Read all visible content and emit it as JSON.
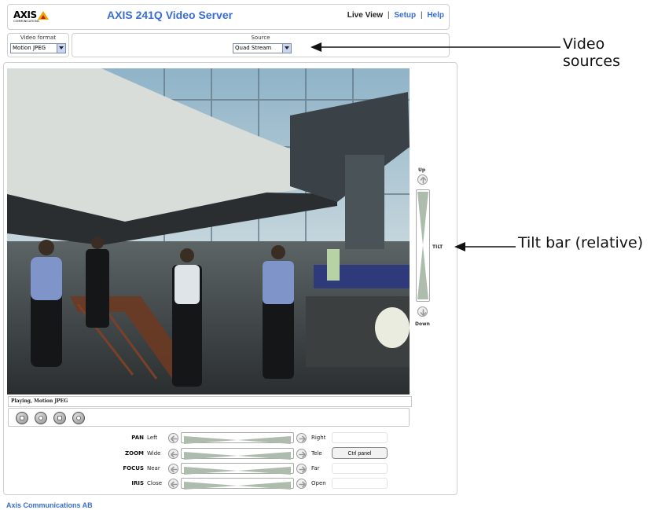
{
  "header": {
    "logo_text": "AXIS",
    "logo_sub": "COMMUNICATIONS",
    "title": "AXIS 241Q Video Server",
    "nav": {
      "live_view": "Live View",
      "separator": "|",
      "setup": "Setup",
      "help": "Help"
    }
  },
  "video_format": {
    "caption": "Video format",
    "selected": "Motion JPEG"
  },
  "source": {
    "caption": "Source",
    "selected": "Quad Stream"
  },
  "video": {
    "status": "Playing, Motion JPEG"
  },
  "tilt": {
    "up_label": "Up",
    "down_label": "Down",
    "bar_label": "TILT"
  },
  "ptz_rows": [
    {
      "name": "PAN",
      "low": "Left",
      "high": "Right"
    },
    {
      "name": "ZOOM",
      "low": "Wide",
      "high": "Tele"
    },
    {
      "name": "FOCUS",
      "low": "Near",
      "high": "Far"
    },
    {
      "name": "IRIS",
      "low": "Close",
      "high": "Open"
    }
  ],
  "ctrl_panel_label": "Ctrl panel",
  "footer": "Axis Communications AB",
  "annotations": {
    "video_sources": "Video sources",
    "tilt_bar": "Tilt bar (relative)"
  },
  "colors": {
    "accent": "#3a6dd1",
    "logo_yellow": "#f5a300",
    "logo_red": "#c41a1a"
  },
  "icons": [
    "stop-icon",
    "snapshot-icon",
    "pause-icon",
    "ptz-icon",
    "arrow-up-icon",
    "arrow-down-icon",
    "arrow-left-icon",
    "arrow-right-icon"
  ]
}
